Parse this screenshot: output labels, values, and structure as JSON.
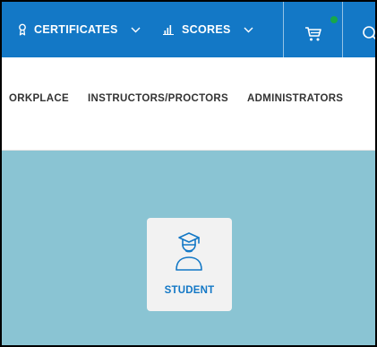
{
  "topnav": {
    "certificates_label": "CERTIFICATES",
    "scores_label": "SCORES",
    "icons": [
      "certificate-icon",
      "bar-chart-icon",
      "chevron-down-icon",
      "cart-icon",
      "search-icon"
    ],
    "background_color": "#1378c6",
    "cart_badge_color": "#17a84a"
  },
  "subnav": {
    "items": [
      {
        "label": "ORKPLACE"
      },
      {
        "label": "INSTRUCTORS/PROCTORS"
      },
      {
        "label": "ADMINISTRATORS"
      }
    ]
  },
  "hero": {
    "background_color": "#8ac4d3",
    "student_card": {
      "label": "STUDENT",
      "icon": "student-graduate-icon"
    }
  }
}
